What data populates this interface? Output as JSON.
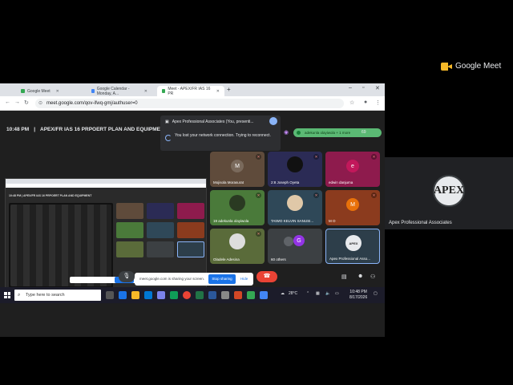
{
  "meet_brand": {
    "label": "Google Meet"
  },
  "presenter": {
    "initials": "APEX",
    "name": "Apex Professional Associates"
  },
  "browser": {
    "tabs": [
      {
        "label": "Google Meet",
        "active": false
      },
      {
        "label": "Google Calendar - Monday, A...",
        "active": false
      },
      {
        "label": "Meet - APEX/FR IAS 16 PR",
        "active": true
      }
    ],
    "url": "meet.google.com/qov-ifwq-gmj/authuser=0"
  },
  "meeting": {
    "time": "10:48 PM",
    "separator": "|",
    "title": "APEX/FR IAS 16 PRPOERT PLAN AND EQUIPMENT",
    "presenting_notice": "Apex Professional Associates (You, presenti...",
    "network_notice": "You lost your network connection. Trying to reconnect.",
    "raised_hands": "adekunla olayiwola + 1 more",
    "participant_count": "69"
  },
  "participants": [
    {
      "name": "Mojisola Morasurat",
      "initial": "M",
      "color": "#5f4b3b"
    },
    {
      "name": "Joseph Oyeta",
      "initial": "",
      "color": "#2b2b55",
      "prefix": "2:8"
    },
    {
      "name": "edwin danjuma",
      "initial": "e",
      "color": "#8e1b4d"
    },
    {
      "name": "adekunla olayiwola",
      "initial": "",
      "color": "#4a7a3a",
      "prefix": "19"
    },
    {
      "name": "TAIWO KELVIN SANUSI...",
      "initial": "",
      "color": "#2f4858"
    },
    {
      "name": "M O",
      "initial": "M",
      "color": "#8b3b1e"
    },
    {
      "name": "Oladele Adesina",
      "initial": "",
      "color": "#5a6b3a"
    },
    {
      "name": "60 others",
      "initial": "G",
      "color": "#3c4043"
    },
    {
      "name": "Apex Professional Asso...",
      "initial": "APEX",
      "color": "#2d3e4a"
    }
  ],
  "nested_screen": {
    "title": "10:48 PM | APEX/FR IAS 16 PRPOERT PLAN AND EQUIPMENT"
  },
  "share_bar": {
    "text": "meet.google.com is sharing your screen.",
    "stop_label": "Stop sharing",
    "hide_label": "Hide"
  },
  "taskbar": {
    "search_placeholder": "Type here to search",
    "weather": "28°C",
    "time": "10:48 PM",
    "date": "8/17/2026"
  }
}
